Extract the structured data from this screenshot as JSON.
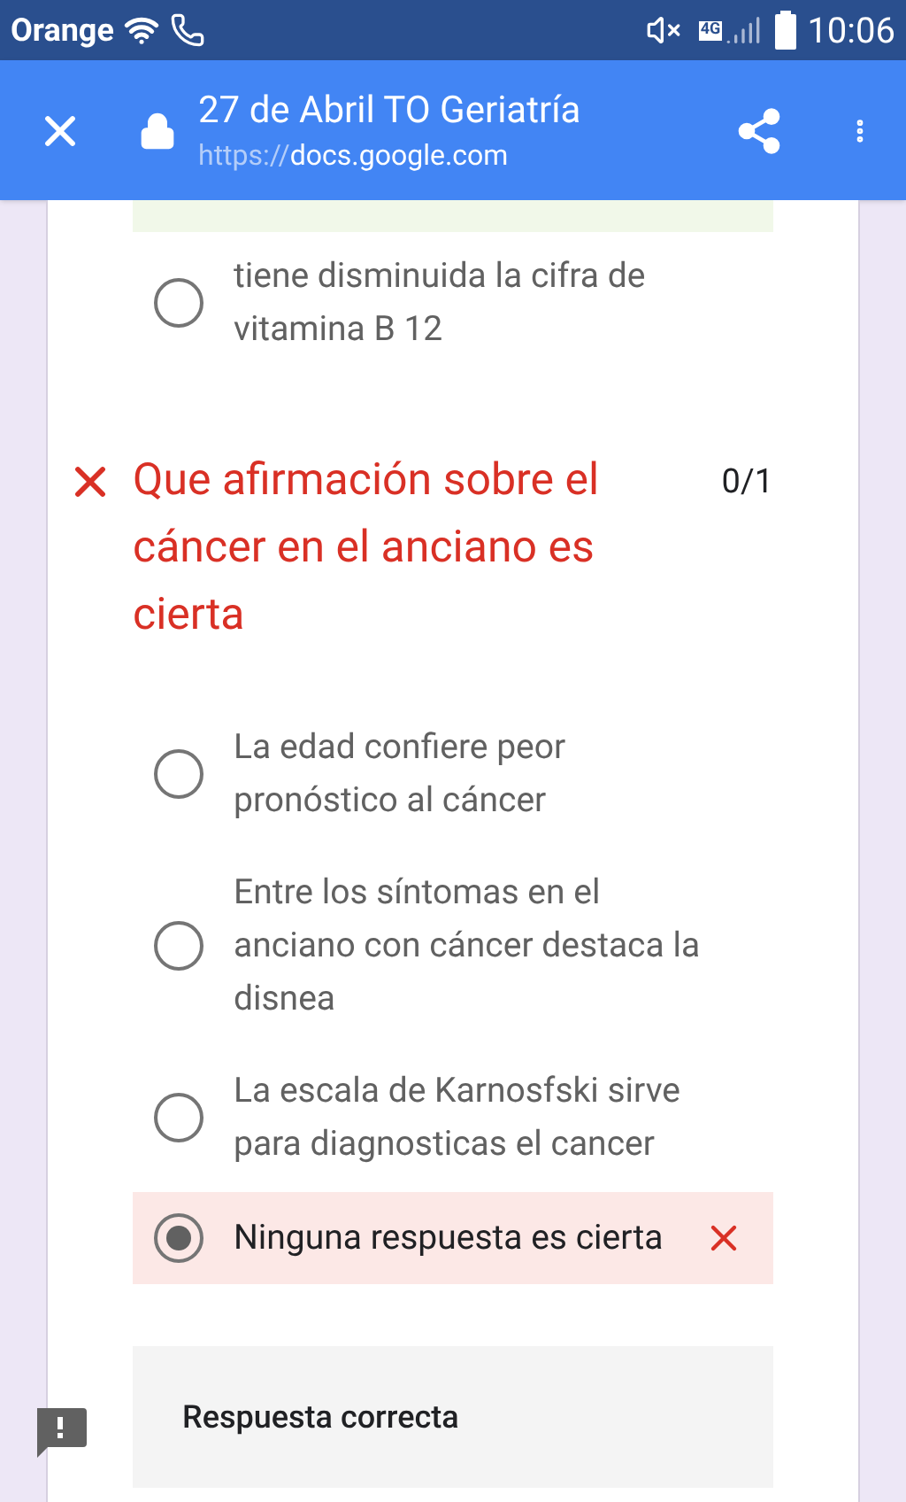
{
  "status_bar": {
    "carrier": "Orange",
    "network": "4G",
    "time": "10:06"
  },
  "toolbar": {
    "title": "27 de Abril TO Geriatría",
    "url_scheme": "https://",
    "url_host": "docs.google.com"
  },
  "previous_option": {
    "text": "tiene disminuida la cifra de vitamina B 12",
    "selected": false
  },
  "question": {
    "title": "Que afirmación sobre el cáncer en el anciano es cierta",
    "correct": false,
    "score": "0/1",
    "options": [
      {
        "text": "La edad confiere peor pronóstico al cáncer",
        "selected": false
      },
      {
        "text": "Entre los síntomas en el anciano con cáncer destaca la disnea",
        "selected": false
      },
      {
        "text": "La escala de Karnosfski sirve para diagnosticas el cancer",
        "selected": false
      },
      {
        "text": "Ninguna respuesta es cierta",
        "selected": true
      }
    ]
  },
  "feedback": {
    "heading": "Respuesta correcta"
  }
}
